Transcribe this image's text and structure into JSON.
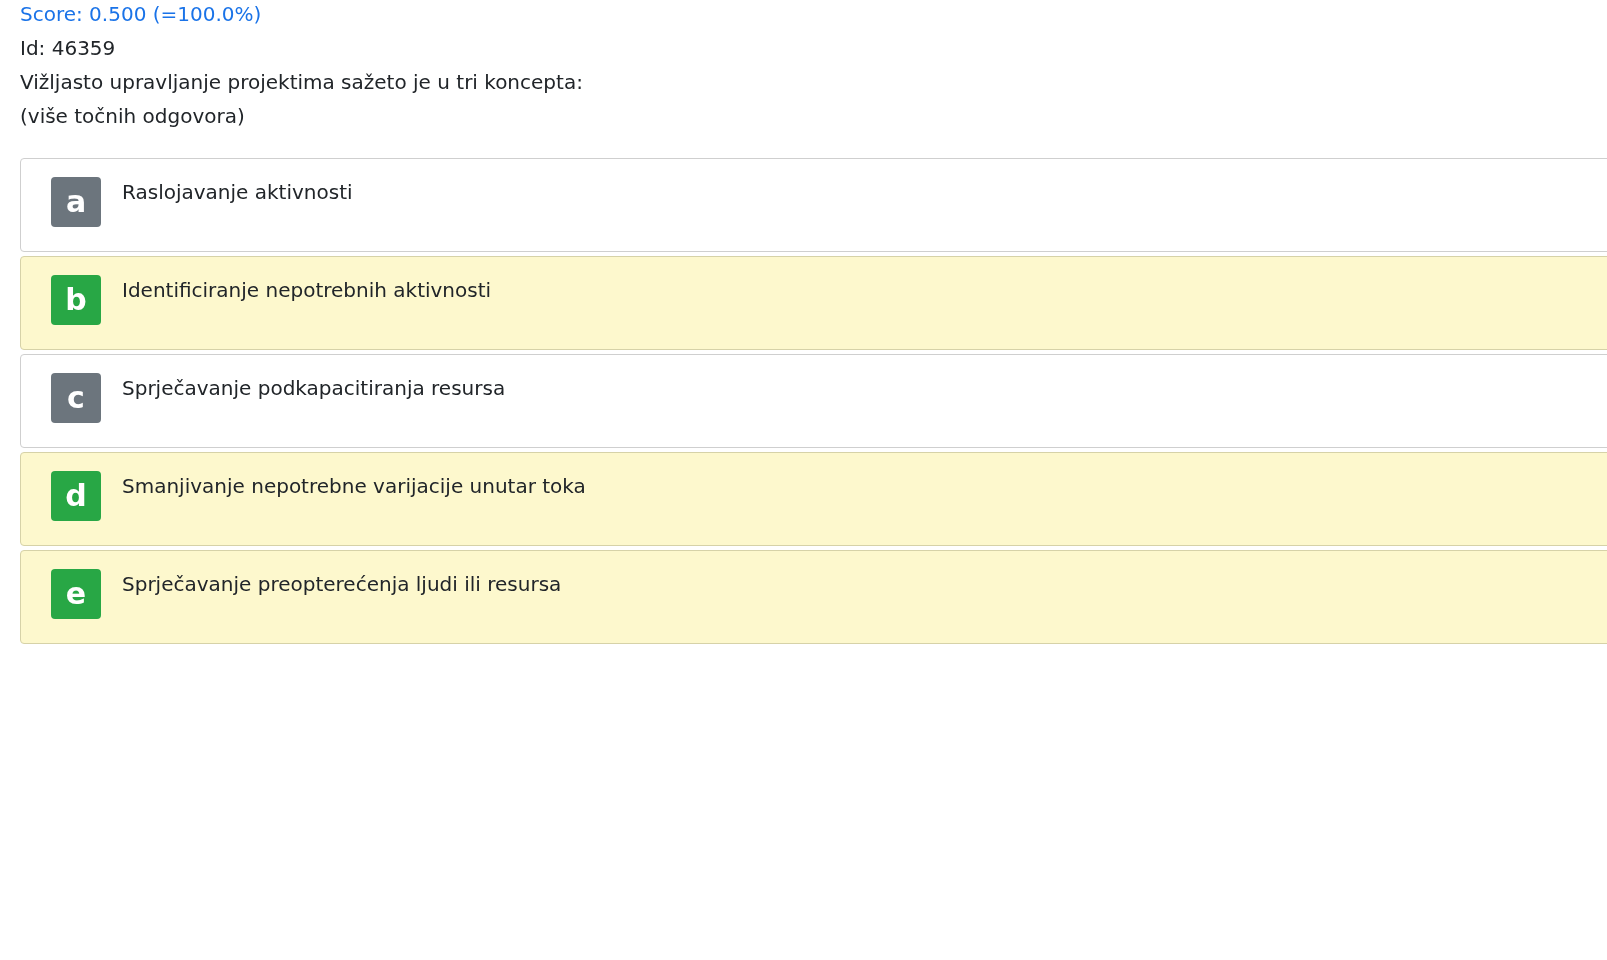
{
  "score": "Score: 0.500 (=100.0%)",
  "id": "Id: 46359",
  "question": "Vižljasto upravljanje projektima sažeto je u tri koncepta:",
  "hint": "(više točnih odgovora)",
  "options": [
    {
      "letter": "a",
      "text": "Raslojavanje aktivnosti",
      "selected": false
    },
    {
      "letter": "b",
      "text": "Identificiranje nepotrebnih aktivnosti",
      "selected": true
    },
    {
      "letter": "c",
      "text": "Sprječavanje podkapacitiranja resursa",
      "selected": false
    },
    {
      "letter": "d",
      "text": "Smanjivanje nepotrebne varijacije unutar toka",
      "selected": true
    },
    {
      "letter": "e",
      "text": "Sprječavanje preopterećenja ljudi ili resursa",
      "selected": true
    }
  ]
}
